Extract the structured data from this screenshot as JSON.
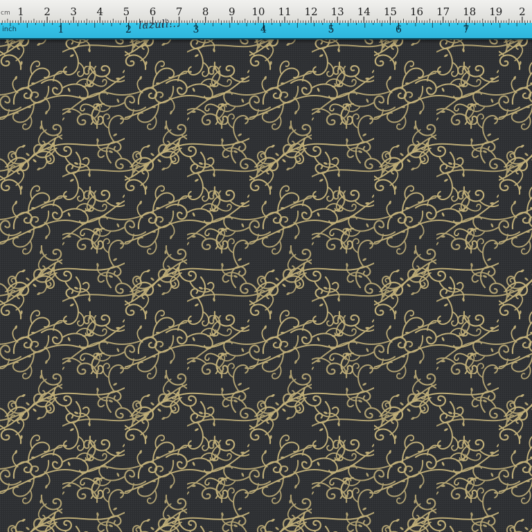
{
  "ruler": {
    "cm_unit_tag": "cm",
    "inch_unit_tag": "inch",
    "cm_labels": [
      "1",
      "2",
      "3",
      "4",
      "5",
      "6",
      "7",
      "8",
      "9",
      "10",
      "11",
      "12",
      "13",
      "14",
      "15",
      "16",
      "17",
      "18",
      "19",
      "2"
    ],
    "inch_labels": [
      "1",
      "2",
      "3",
      "4",
      "5",
      "6",
      "7"
    ],
    "handwritten_note": "lazuli...",
    "colors": {
      "cm_strip": "#e8e8e6",
      "inch_strip": "#34c0e6"
    }
  },
  "fabric": {
    "description_colors": {
      "background": "#2f3134",
      "motif": "#c6b47a"
    },
    "motif": "gold-scroll-vine"
  }
}
